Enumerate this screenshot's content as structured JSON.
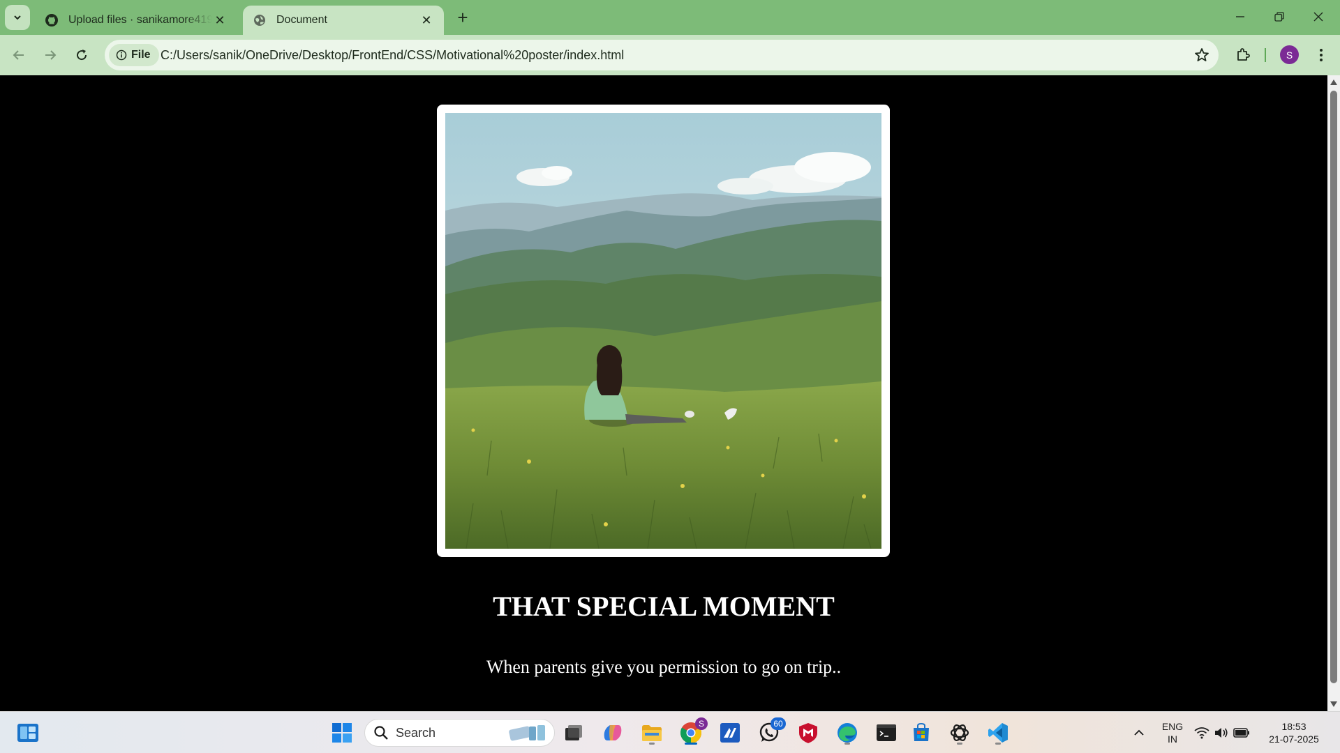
{
  "browser": {
    "tabs": [
      {
        "title": "Upload files · sanikamore419/sa",
        "active": false,
        "icon": "github-icon"
      },
      {
        "title": "Document",
        "active": true,
        "icon": "globe-icon"
      }
    ],
    "address_chip": "File",
    "url": "C:/Users/sanik/OneDrive/Desktop/FrontEnd/CSS/Motivational%20poster/index.html",
    "profile_initial": "S",
    "accent": "#7dbb78"
  },
  "page": {
    "headline": "THAT SPECIAL MOMENT",
    "subline": "When parents give you permission to go on trip..",
    "background": "#000000"
  },
  "taskbar": {
    "search_placeholder": "Search",
    "whatsapp_badge": "60",
    "chrome_badge": "S",
    "lang_line1": "ENG",
    "lang_line2": "IN",
    "time": "18:53",
    "date": "21-07-2025"
  }
}
